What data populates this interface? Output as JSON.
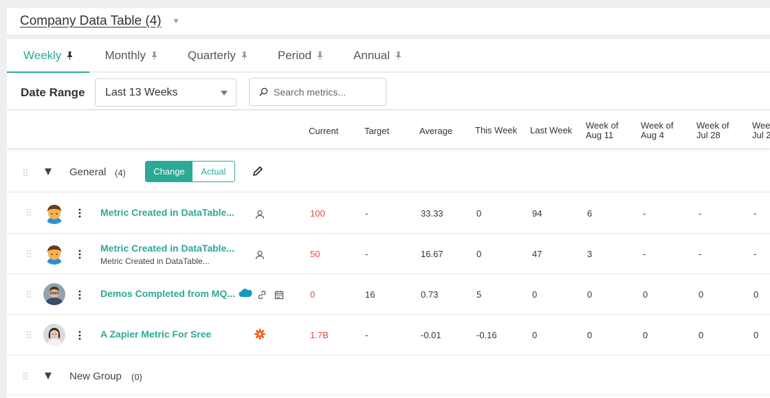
{
  "header": {
    "title": "Company Data Table (4)"
  },
  "tabs": [
    {
      "label": "Weekly",
      "active": true
    },
    {
      "label": "Monthly",
      "active": false
    },
    {
      "label": "Quarterly",
      "active": false
    },
    {
      "label": "Period",
      "active": false
    },
    {
      "label": "Annual",
      "active": false
    }
  ],
  "filters": {
    "date_range_label": "Date Range",
    "date_range_value": "Last 13 Weeks",
    "search_placeholder": "Search metrics..."
  },
  "columns": {
    "current": "Current",
    "target": "Target",
    "average": "Average",
    "this_week": "This Week",
    "last_week": "Last Week",
    "w1a": "Week of",
    "w1b": "Aug 11",
    "w2a": "Week of",
    "w2b": "Aug 4",
    "w3a": "Week of",
    "w3b": "Jul 28",
    "w4a": "Wee",
    "w4b": "Jul 2"
  },
  "groups": [
    {
      "name": "General",
      "count": "(4)",
      "toggle_on": "Change",
      "toggle_off": "Actual"
    },
    {
      "name": "New Group",
      "count": "(0)"
    }
  ],
  "rows": [
    {
      "name": "Metric Created in DataTable...",
      "subtitle": "",
      "current": "100",
      "target": "-",
      "average": "33.33",
      "this_week": "0",
      "last_week": "94",
      "w1": "6",
      "w2": "-",
      "w3": "-",
      "w4": "-"
    },
    {
      "name": "Metric Created in DataTable...",
      "subtitle": "Metric Created in DataTable...",
      "current": "50",
      "target": "-",
      "average": "16.67",
      "this_week": "0",
      "last_week": "47",
      "w1": "3",
      "w2": "-",
      "w3": "-",
      "w4": "-"
    },
    {
      "name": "Demos Completed from MQ...",
      "subtitle": "",
      "current": "0",
      "target": "16",
      "average": "0.73",
      "this_week": "5",
      "last_week": "0",
      "w1": "0",
      "w2": "0",
      "w3": "0",
      "w4": "0"
    },
    {
      "name": "A Zapier Metric For Sree",
      "subtitle": "",
      "current": "1.7B",
      "target": "-",
      "average": "-0.01",
      "this_week": "-0.16",
      "last_week": "0",
      "w1": "0",
      "w2": "0",
      "w3": "0",
      "w4": "0"
    }
  ],
  "colors": {
    "accent": "#2ba994",
    "negative": "#e8453c",
    "salesforce": "#1798c1",
    "zapier": "#ff4a00"
  }
}
